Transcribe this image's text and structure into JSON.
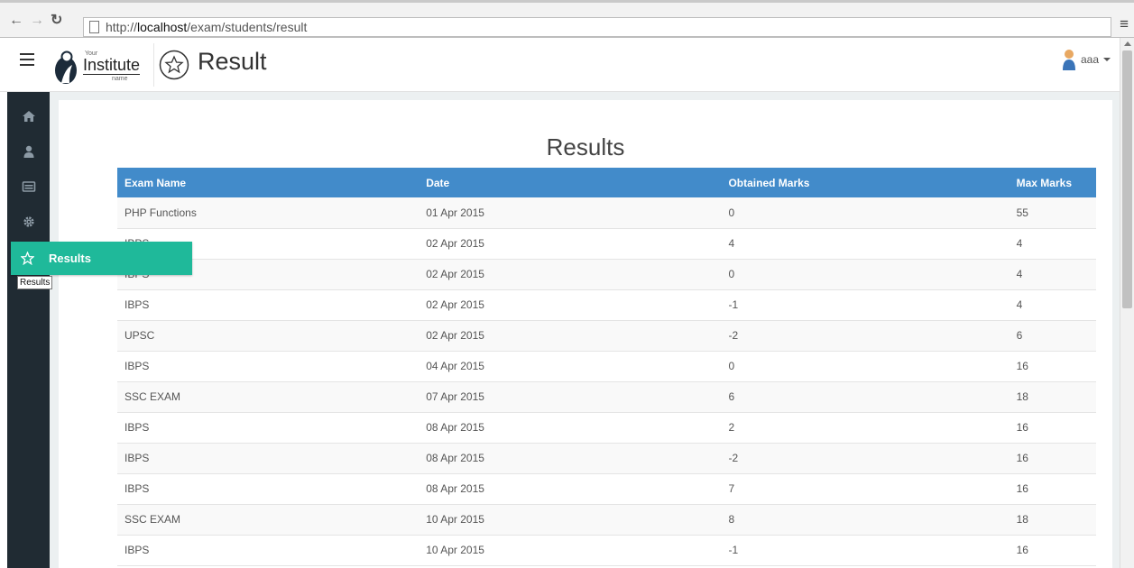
{
  "browser": {
    "url_prefix": "http://",
    "url_host": "localhost",
    "url_path": "/exam/students/result"
  },
  "header": {
    "logo": {
      "top": "Your",
      "main": "Institute",
      "sub": "name"
    },
    "page_title": "Result",
    "user": "aaa"
  },
  "sidebar": {
    "items": [
      {
        "icon": "home-icon"
      },
      {
        "icon": "user-icon"
      },
      {
        "icon": "card-icon"
      },
      {
        "icon": "gear-icon"
      }
    ],
    "active": {
      "icon": "star-icon",
      "label": "Results"
    },
    "tooltip": "Results"
  },
  "results": {
    "heading": "Results",
    "columns": [
      "Exam Name",
      "Date",
      "Obtained Marks",
      "Max Marks"
    ],
    "rows": [
      [
        "PHP Functions",
        "01 Apr 2015",
        "0",
        "55"
      ],
      [
        "IBPS",
        "02 Apr 2015",
        "4",
        "4"
      ],
      [
        "IBPS",
        "02 Apr 2015",
        "0",
        "4"
      ],
      [
        "IBPS",
        "02 Apr 2015",
        "-1",
        "4"
      ],
      [
        "UPSC",
        "02 Apr 2015",
        "-2",
        "6"
      ],
      [
        "IBPS",
        "04 Apr 2015",
        "0",
        "16"
      ],
      [
        "SSC EXAM",
        "07 Apr 2015",
        "6",
        "18"
      ],
      [
        "IBPS",
        "08 Apr 2015",
        "2",
        "16"
      ],
      [
        "IBPS",
        "08 Apr 2015",
        "-2",
        "16"
      ],
      [
        "IBPS",
        "08 Apr 2015",
        "7",
        "16"
      ],
      [
        "SSC EXAM",
        "10 Apr 2015",
        "8",
        "18"
      ],
      [
        "IBPS",
        "10 Apr 2015",
        "-1",
        "16"
      ]
    ]
  },
  "colors": {
    "sidebar_bg": "#202b33",
    "active_item": "#1fb99a",
    "table_header": "#428bca",
    "content_bg": "#ecf0f1"
  }
}
